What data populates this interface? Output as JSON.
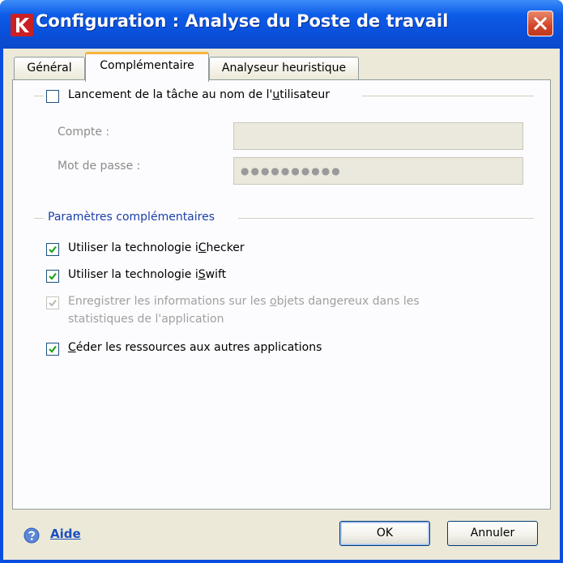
{
  "window": {
    "title": "Configuration : Analyse du Poste de travail",
    "title_color": "#0a4ee0",
    "close_color": "#d2452a"
  },
  "tabs": [
    {
      "label": "Général",
      "active": false
    },
    {
      "label": "Complémentaire",
      "active": true
    },
    {
      "label": "Analyseur heuristique",
      "active": false
    }
  ],
  "run_as": {
    "checkbox_label_pre": "Lancement de la tâche au nom de l'",
    "checkbox_label_ul": "u",
    "checkbox_label_post": "tilisateur",
    "checked": false,
    "account_label": "Compte :",
    "account_value": "",
    "password_label": "Mot de passe :",
    "password_value": "●●●●●●●●●●"
  },
  "extra": {
    "group_label": "Paramètres complémentaires",
    "options": [
      {
        "pre": "Utiliser la technologie i",
        "ul": "C",
        "post": "hecker",
        "checked": true,
        "disabled": false
      },
      {
        "pre": "Utiliser la technologie i",
        "ul": "S",
        "post": "wift",
        "checked": true,
        "disabled": false
      },
      {
        "pre": "Enregistrer les informations sur les ",
        "ul": "o",
        "post": "bjets dangereux dans les",
        "line2": "statistiques de l'application",
        "checked": true,
        "disabled": true
      },
      {
        "pre": "",
        "ul": "C",
        "post": "éder les ressources aux autres applications",
        "checked": true,
        "disabled": false
      }
    ]
  },
  "footer": {
    "help_label": "Aide",
    "ok_label": "OK",
    "cancel_label": "Annuler",
    "link_color": "#1a4fbf"
  }
}
